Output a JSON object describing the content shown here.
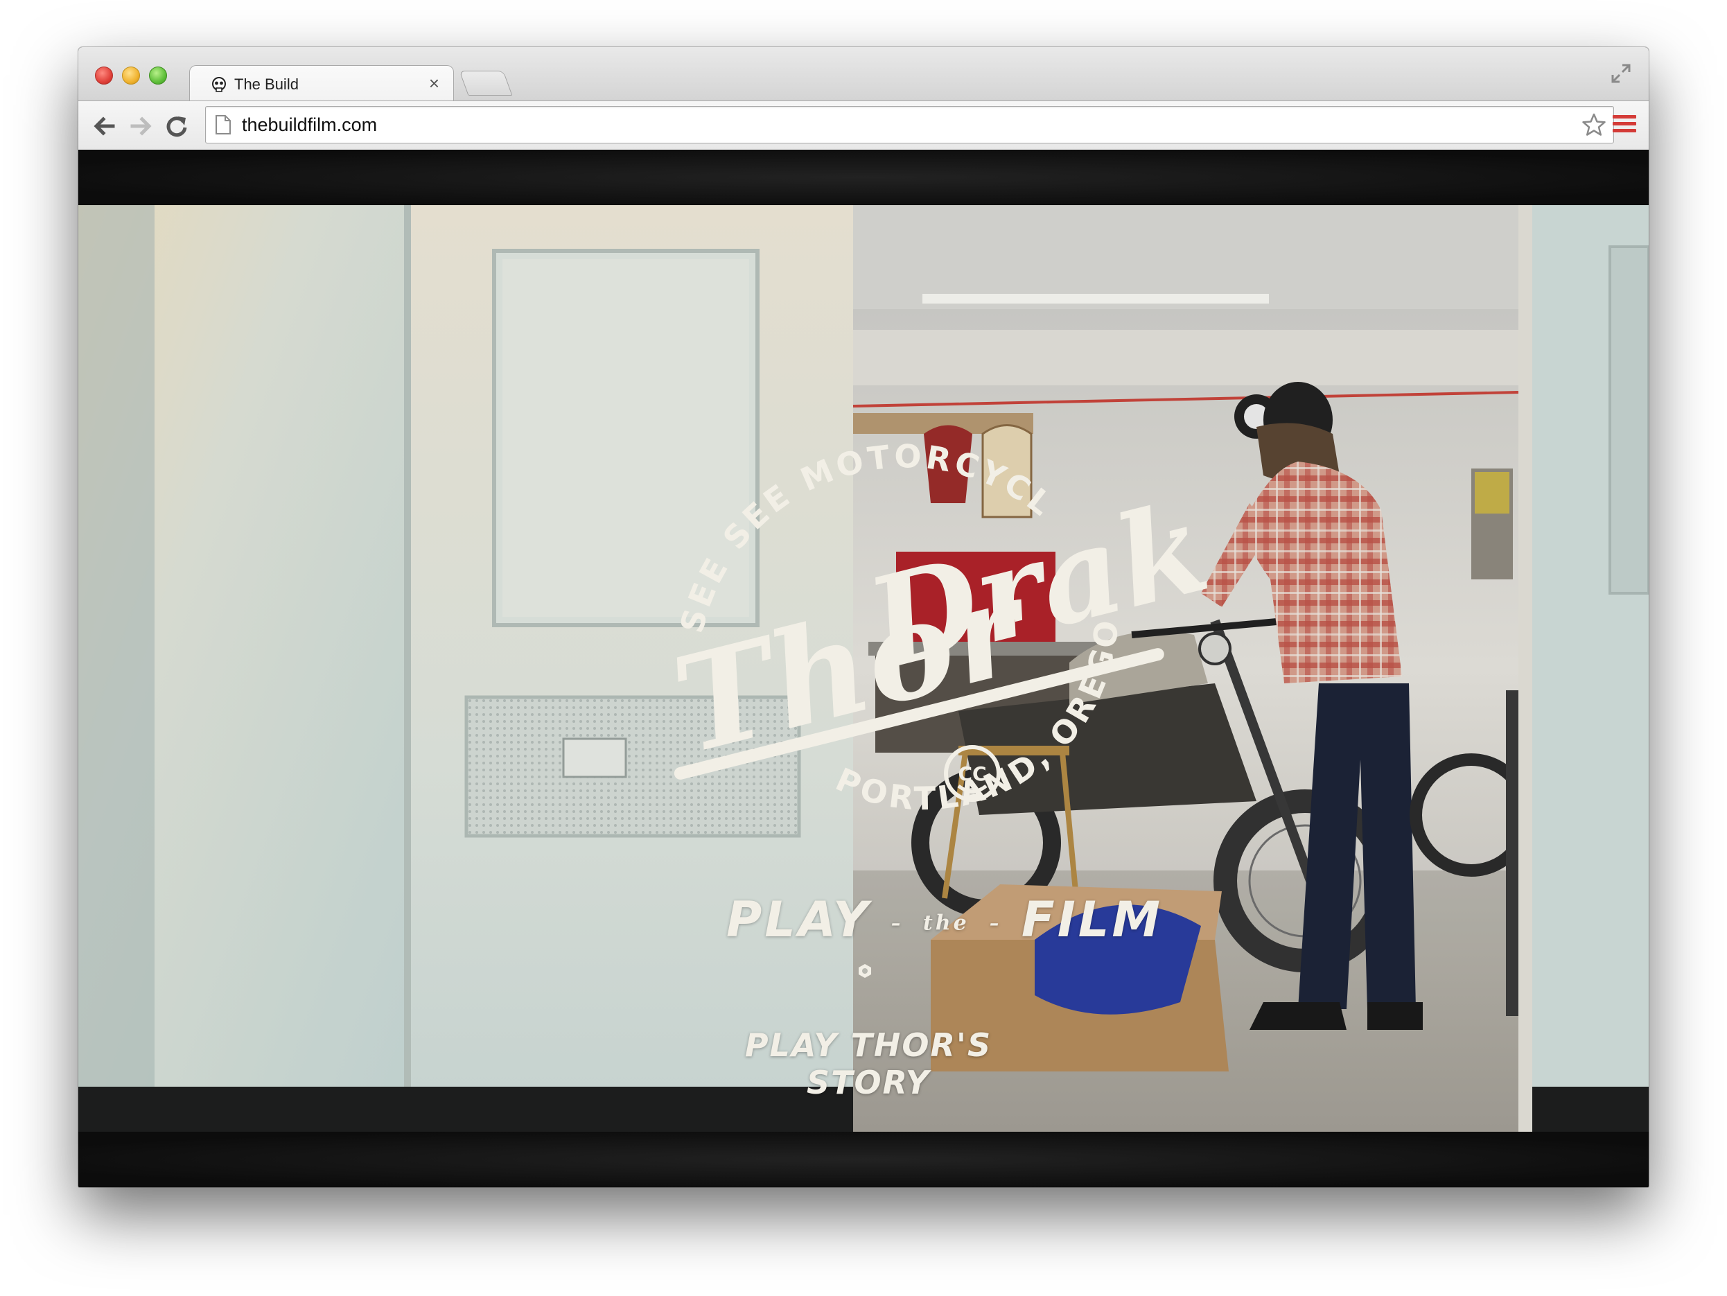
{
  "browser": {
    "tab": {
      "title": "The Build",
      "close_glyph": "×",
      "favicon": "skull-icon"
    },
    "url": "thebuildfilm.com",
    "icons": [
      "back-arrow-icon",
      "forward-arrow-icon",
      "reload-icon",
      "page-icon",
      "star-icon",
      "menu-icon",
      "fullscreen-icon"
    ],
    "accent_color": "#d43b37"
  },
  "hero": {
    "arc_top": "SEE SEE MOTORCYCLES",
    "name_line_1": "Thor",
    "name_line_2": "Drake",
    "arc_bottom": "PORTLAND, OREGON USA",
    "emblem": "CC",
    "play_word_1": "PLAY",
    "play_the": "the",
    "play_word_2": "FILM",
    "story_link": "PLAY THOR'S STORY",
    "text_color": "#f2efe6"
  }
}
